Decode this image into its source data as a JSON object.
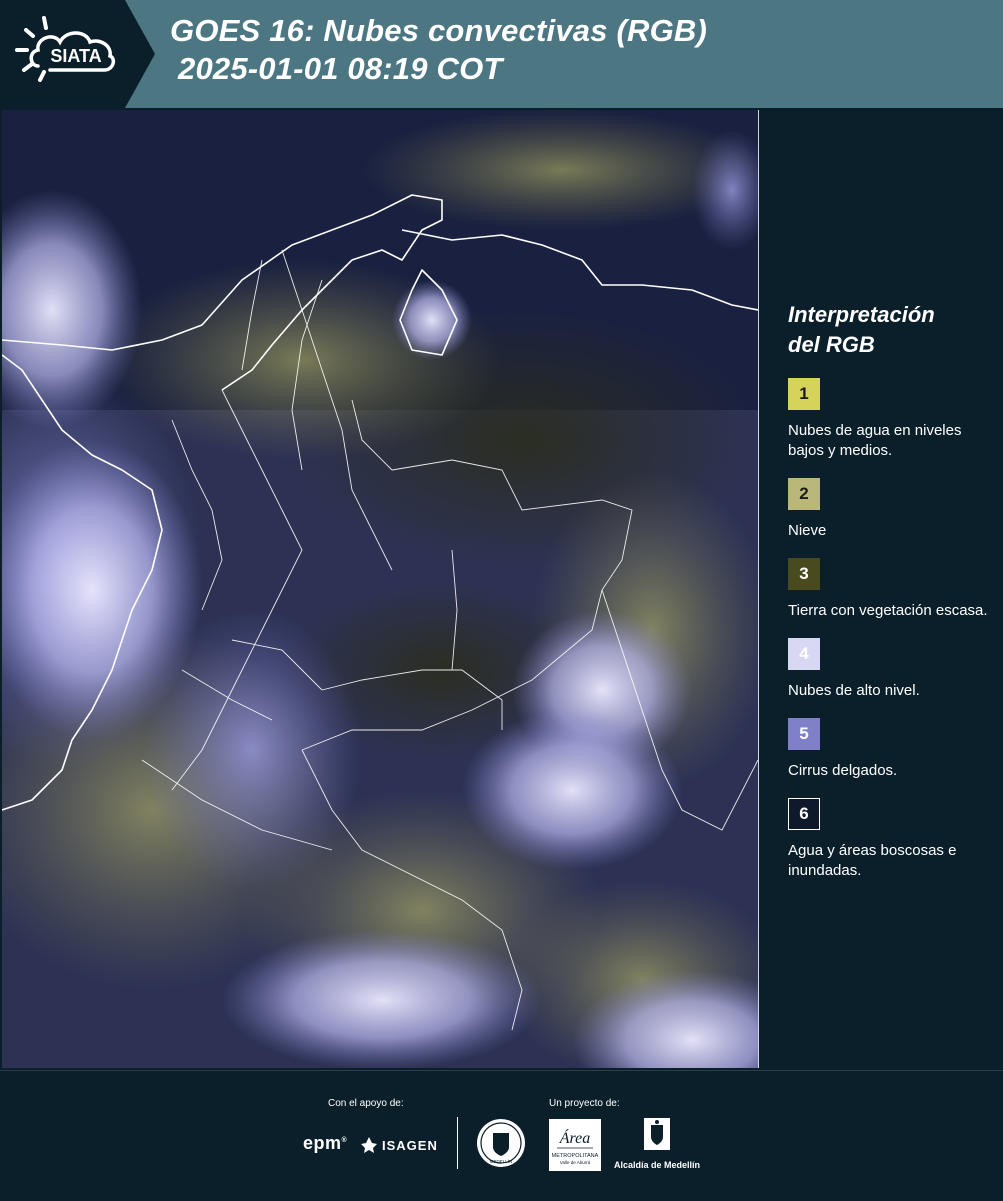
{
  "header": {
    "logo_text": "SIATA",
    "title_line1": "GOES 16: Nubes convectivas (RGB)",
    "title_line2": "2025-01-01 08:19 COT"
  },
  "legend": {
    "title_line1": "Interpretación",
    "title_line2": "del RGB",
    "items": [
      {
        "number": "1",
        "label": "Nubes de agua en niveles bajos y medios.",
        "color": "#d6d35a"
      },
      {
        "number": "2",
        "label": "Nieve",
        "color": "#b9b87a"
      },
      {
        "number": "3",
        "label": "Tierra con vegetación escasa.",
        "color": "#4a4a1f"
      },
      {
        "number": "4",
        "label": "Nubes de alto nivel.",
        "color": "#d9d8f4"
      },
      {
        "number": "5",
        "label": "Cirrus delgados.",
        "color": "#7f80c8"
      },
      {
        "number": "6",
        "label": "Agua y áreas boscosas e inundadas.",
        "color": "#0e1a2c"
      }
    ]
  },
  "footer": {
    "support_label": "Con el apoyo de:",
    "project_label": "Un proyecto de:",
    "epm": "epm",
    "isagen": "ISAGEN",
    "seal_text": "MEDELLÍN",
    "area_text": "Área",
    "area_sub": "METROPOLITANA",
    "area_sub2": "Valle de Aburrá",
    "alcaldia": "Alcaldía de Medellín"
  }
}
